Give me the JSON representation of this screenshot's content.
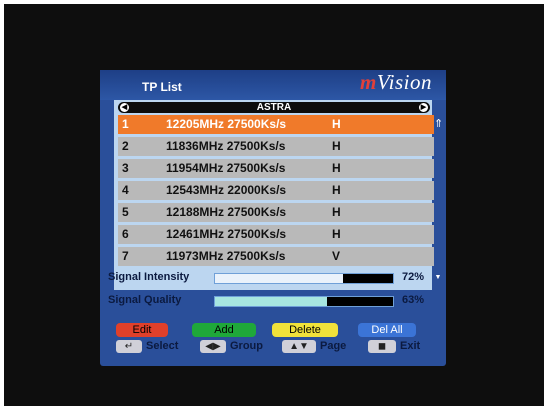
{
  "screen": {
    "title": "TP List",
    "brand_m": "m",
    "brand_rest": "Vision",
    "satellite": "ASTRA"
  },
  "transponders": [
    {
      "num": "1",
      "freq": "12205MHz 27500Ks/s",
      "pol": "H",
      "selected": true
    },
    {
      "num": "2",
      "freq": "11836MHz 27500Ks/s",
      "pol": "H",
      "selected": false
    },
    {
      "num": "3",
      "freq": "11954MHz 27500Ks/s",
      "pol": "H",
      "selected": false
    },
    {
      "num": "4",
      "freq": "12543MHz 22000Ks/s",
      "pol": "H",
      "selected": false
    },
    {
      "num": "5",
      "freq": "12188MHz 27500Ks/s",
      "pol": "H",
      "selected": false
    },
    {
      "num": "6",
      "freq": "12461MHz 27500Ks/s",
      "pol": "H",
      "selected": false
    },
    {
      "num": "7",
      "freq": "11973MHz 27500Ks/s",
      "pol": "V",
      "selected": false
    }
  ],
  "signal": {
    "intensity_label": "Signal Intensity",
    "intensity_value": "72%",
    "intensity_fraction": 0.72,
    "intensity_color": "#eaf2fb",
    "quality_label": "Signal Quality",
    "quality_value": "63%",
    "quality_fraction": 0.63,
    "quality_color": "#a7e6e0"
  },
  "buttons": {
    "edit": "Edit",
    "add": "Add",
    "delete": "Delete",
    "del_all": "Del All",
    "edit_color": "#e0402a",
    "add_color": "#1fa83a",
    "delete_color": "#f1e23a",
    "del_all_color": "#3b74d6"
  },
  "legend": {
    "select": "Select",
    "group": "Group",
    "page": "Page",
    "exit": "Exit"
  }
}
